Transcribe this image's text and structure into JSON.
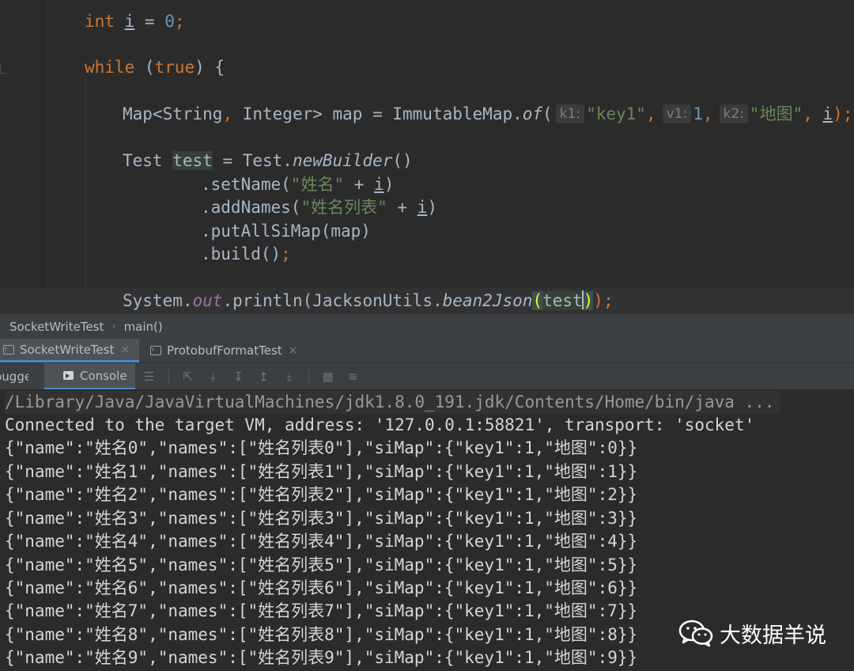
{
  "editor": {
    "line_int": {
      "kw": "int",
      "var": "i",
      "eq": " = ",
      "num": "0",
      "semi": ";"
    },
    "line_while": {
      "kw1": "while",
      "open": " (",
      "kw2": "true",
      "close": ") {"
    },
    "line_map": {
      "decl": "Map<String",
      "comma1": ",",
      "type2": " Integer> map = ImmutableMap.",
      "method": "of",
      "paren": "(",
      "hint_k1": "k1:",
      "arg_k1": "\"key1\"",
      "comma2": ",",
      "hint_v1": "v1:",
      "arg_v1": "1",
      "comma3": ",",
      "hint_k2": "k2:",
      "arg_k2": "\"地图\"",
      "comma4": ", ",
      "arg_i": "i",
      "end": ");"
    },
    "line_test": {
      "type": "Test ",
      "var": "test",
      "rest": " = Test.",
      "method": "newBuilder",
      "paren": "()"
    },
    "line_setname": {
      "call": ".setName(",
      "str": "\"姓名\"",
      "plus": " + ",
      "var": "i",
      "close": ")"
    },
    "line_addnames": {
      "call": ".addNames(",
      "str": "\"姓名列表\"",
      "plus": " + ",
      "var": "i",
      "close": ")"
    },
    "line_putall": {
      "call": ".putAllSiMap(map)"
    },
    "line_build": {
      "call": ".build()",
      "semi": ";"
    },
    "line_println": {
      "sys": "System.",
      "field": "out",
      "call": ".println(JacksonUtils.",
      "method": "bean2Json",
      "open": "(",
      "arg": "test",
      "close": ")",
      "end": ");"
    }
  },
  "breadcrumb": {
    "class_name": "SocketWriteTest",
    "separator": "›",
    "method": "main()"
  },
  "run_tabs": [
    {
      "label": "SocketWriteTest",
      "close": "×"
    },
    {
      "label": "ProtobufFormatTest",
      "close": "×"
    }
  ],
  "toolbar": {
    "debugger_label": "Debugger",
    "console_label": "Console"
  },
  "console": {
    "lines": [
      "/Library/Java/JavaVirtualMachines/jdk1.8.0_191.jdk/Contents/Home/bin/java ...",
      "Connected to the target VM, address: '127.0.0.1:58821', transport: 'socket'",
      "{\"name\":\"姓名0\",\"names\":[\"姓名列表0\"],\"siMap\":{\"key1\":1,\"地图\":0}}",
      "{\"name\":\"姓名1\",\"names\":[\"姓名列表1\"],\"siMap\":{\"key1\":1,\"地图\":1}}",
      "{\"name\":\"姓名2\",\"names\":[\"姓名列表2\"],\"siMap\":{\"key1\":1,\"地图\":2}}",
      "{\"name\":\"姓名3\",\"names\":[\"姓名列表3\"],\"siMap\":{\"key1\":1,\"地图\":3}}",
      "{\"name\":\"姓名4\",\"names\":[\"姓名列表4\"],\"siMap\":{\"key1\":1,\"地图\":4}}",
      "{\"name\":\"姓名5\",\"names\":[\"姓名列表5\"],\"siMap\":{\"key1\":1,\"地图\":5}}",
      "{\"name\":\"姓名6\",\"names\":[\"姓名列表6\"],\"siMap\":{\"key1\":1,\"地图\":6}}",
      "{\"name\":\"姓名7\",\"names\":[\"姓名列表7\"],\"siMap\":{\"key1\":1,\"地图\":7}}",
      "{\"name\":\"姓名8\",\"names\":[\"姓名列表8\"],\"siMap\":{\"key1\":1,\"地图\":8}}",
      "{\"name\":\"姓名9\",\"names\":[\"姓名列表9\"],\"siMap\":{\"key1\":1,\"地图\":9}}"
    ]
  },
  "watermark": {
    "text": "大数据羊说",
    "logo": "wechat-logo"
  },
  "colors": {
    "editor_bg": "#2b2b2b",
    "keyword": "#cc7832",
    "number": "#6897bb",
    "string": "#6a8759",
    "field": "#9876aa",
    "plain": "#a9b7c6",
    "panel_bg": "#3c3f41",
    "accent": "#4a88c7"
  }
}
